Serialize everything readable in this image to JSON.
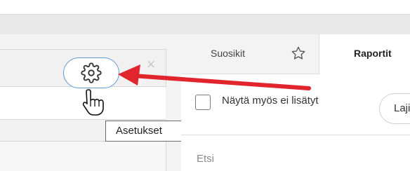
{
  "tabs": {
    "favorites_label": "Suosikit",
    "reports_label": "Raportit"
  },
  "filters": {
    "show_unadded_label": "Näytä myös ei lisätyt",
    "type_select_label": "Laji"
  },
  "search": {
    "placeholder": "Etsi"
  },
  "settings": {
    "tooltip": "Asetukset"
  },
  "icons": {
    "gear": "gear-icon",
    "close": "close-icon",
    "star": "star-icon",
    "cursor": "hand-pointer-icon",
    "arrow": "arrow-annotation"
  },
  "colors": {
    "annotation_arrow": "#e2242c",
    "focus_ring": "#5a9bd6"
  }
}
